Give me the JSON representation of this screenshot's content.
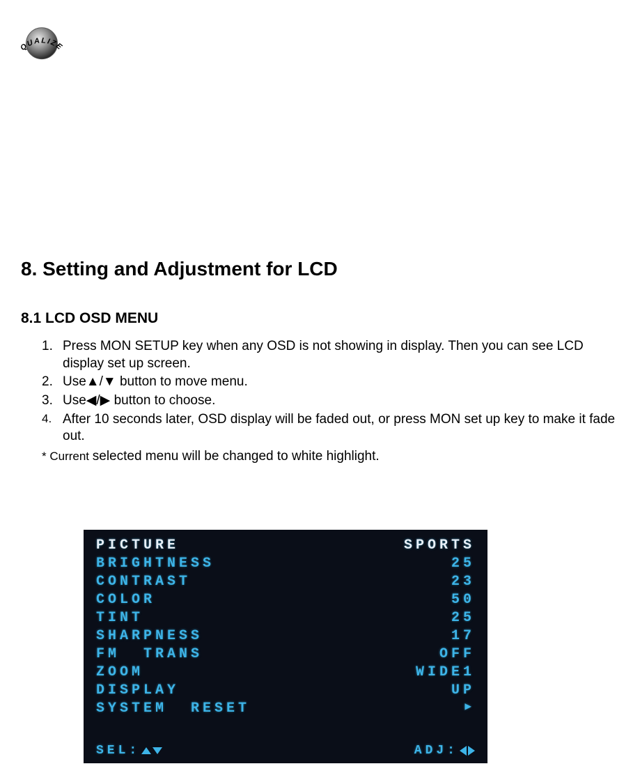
{
  "badge": {
    "label": "EQUALIZER"
  },
  "section": {
    "title": "8. Setting and Adjustment for LCD",
    "subtitle": "8.1 LCD OSD MENU"
  },
  "instructions": {
    "items": [
      "Press MON SETUP key when any OSD is not showing in display. Then you can see LCD display set up screen.",
      "Use▲/▼ button to move menu.",
      "Use◀/▶ button to choose.",
      "After 10 seconds later, OSD display will be faded out, or press MON set up key to make it fade out."
    ],
    "note_prefix": "* Current ",
    "note_rest": "selected menu will be changed to white highlight."
  },
  "osd": {
    "rows": [
      {
        "label": "PICTURE",
        "value": "SPORTS",
        "highlight": true
      },
      {
        "label": "BRIGHTNESS",
        "value": "25",
        "highlight": false
      },
      {
        "label": "CONTRAST",
        "value": "23",
        "highlight": false
      },
      {
        "label": "COLOR",
        "value": "50",
        "highlight": false
      },
      {
        "label": "TINT",
        "value": "25",
        "highlight": false
      },
      {
        "label": "SHARPNESS",
        "value": "17",
        "highlight": false
      },
      {
        "label": "FM TRANS",
        "value": "OFF",
        "highlight": false
      },
      {
        "label": "ZOOM",
        "value": "WIDE1",
        "highlight": false
      },
      {
        "label": "DISPLAY",
        "value": "UP",
        "highlight": false
      },
      {
        "label": "SYSTEM RESET",
        "value": "▶",
        "highlight": false
      }
    ],
    "footer": {
      "sel_label": "SEL:",
      "adj_label": "ADJ:"
    }
  }
}
